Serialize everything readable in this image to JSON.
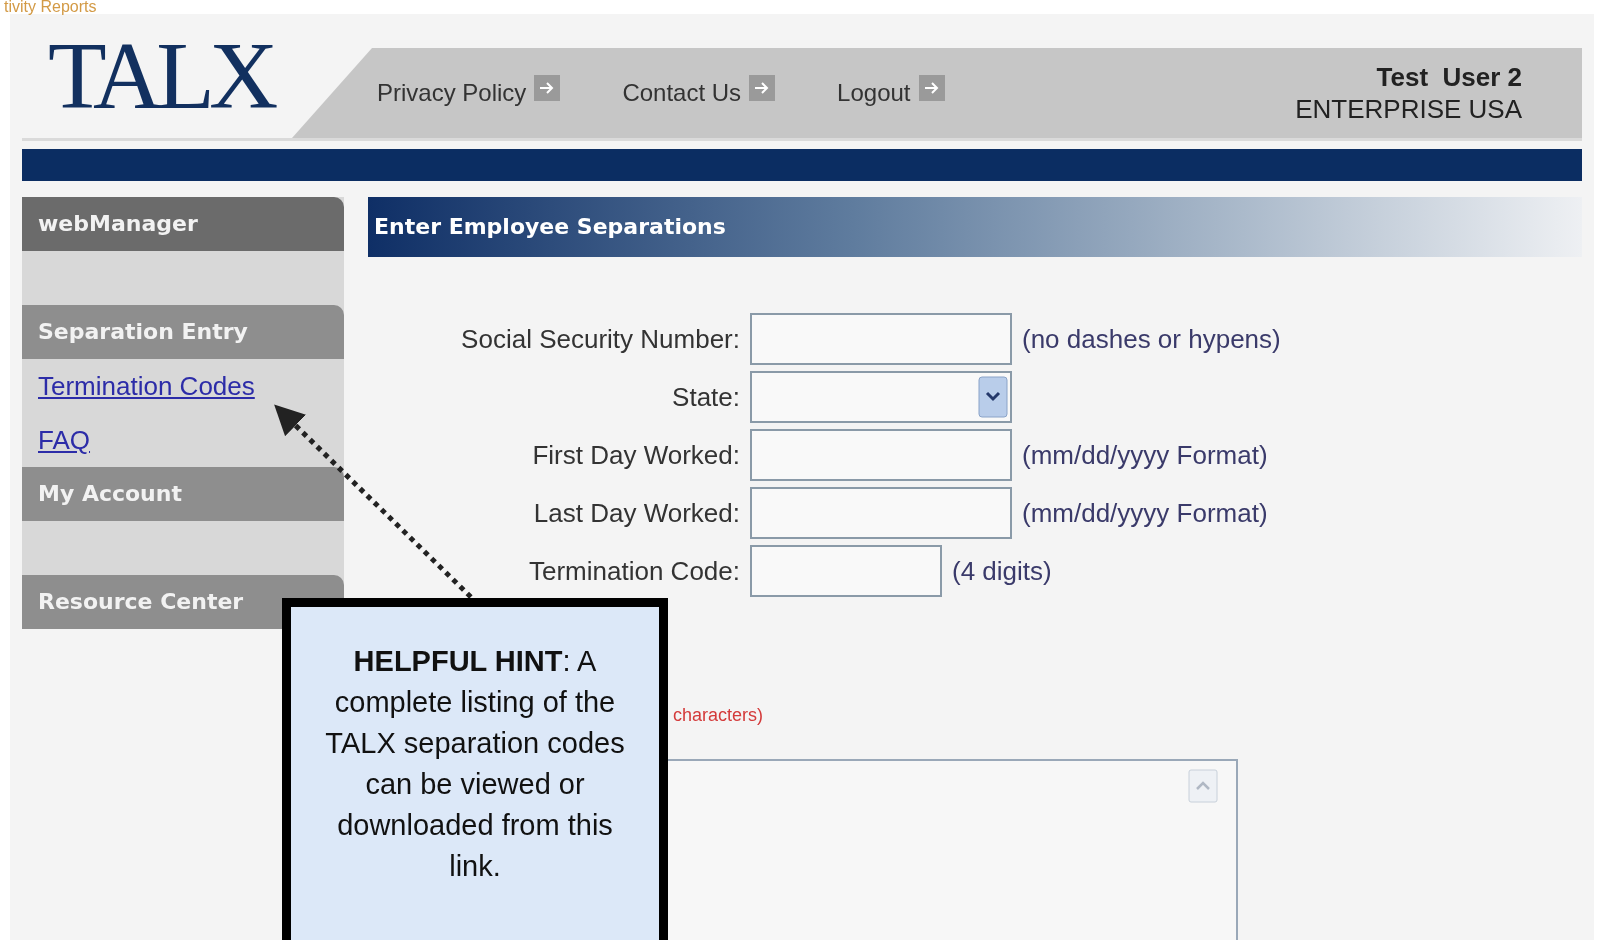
{
  "slide_title": "tivity Reports",
  "logo": "TALX",
  "nav_links": [
    {
      "label": "Privacy Policy"
    },
    {
      "label": "Contact Us"
    },
    {
      "label": "Logout"
    }
  ],
  "user": {
    "name": "Test  User 2",
    "company": "ENTERPRISE USA"
  },
  "sidebar": {
    "sections": [
      {
        "title": "webManager"
      },
      {
        "title": "Separation Entry",
        "links": [
          "Termination Codes",
          "FAQ"
        ]
      },
      {
        "title": "My Account"
      },
      {
        "title": "Resource Center"
      }
    ]
  },
  "page_title": "Enter Employee Separations",
  "form": {
    "fields": [
      {
        "label": "Social Security Number:",
        "kind": "text",
        "hint": "(no dashes or hypens)"
      },
      {
        "label": "State:",
        "kind": "select"
      },
      {
        "label": "First Day Worked:",
        "kind": "text",
        "hint": "(mm/dd/yyyy Format)"
      },
      {
        "label": "Last Day Worked:",
        "kind": "text",
        "hint": "(mm/dd/yyyy Format)"
      },
      {
        "label": "Termination Code:",
        "kind": "short",
        "hint": "(4 digits)"
      }
    ],
    "comment_hint": "characters)"
  },
  "callout": {
    "text": "**HELPFUL HINT**: A complete listing of the TALX separation codes can be viewed or downloaded from this link."
  }
}
